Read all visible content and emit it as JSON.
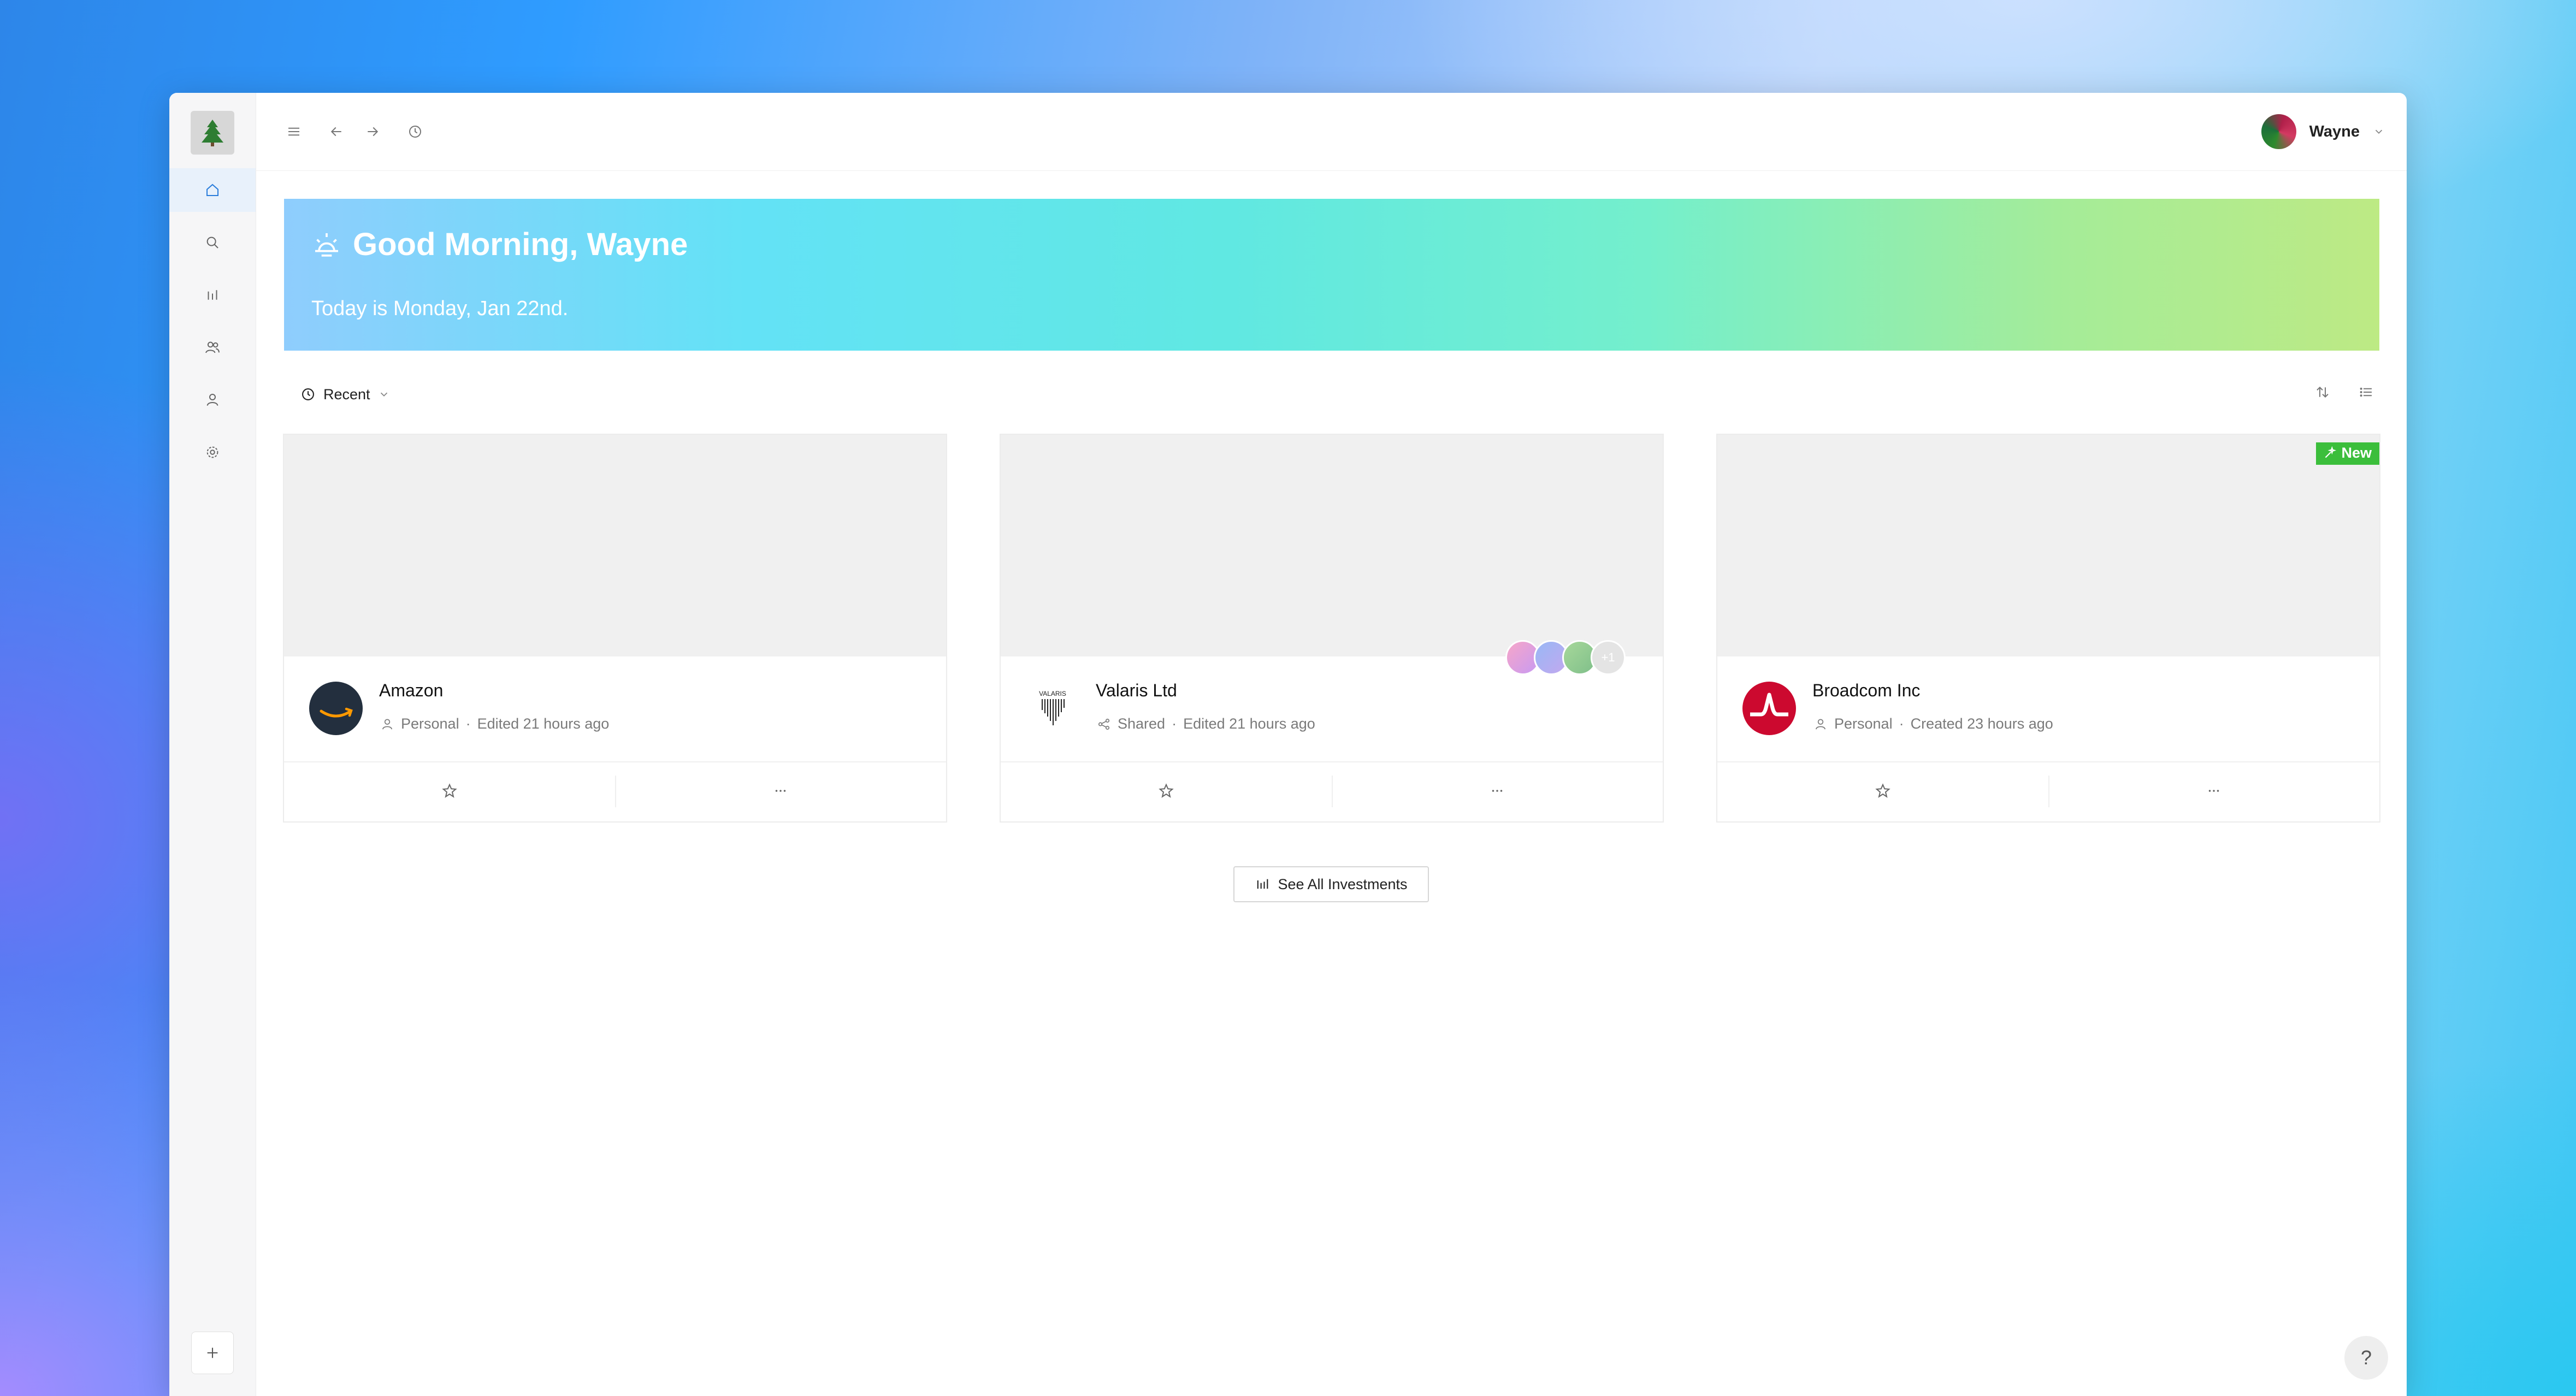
{
  "app": {
    "colors": {
      "accent": "#2a7ddb",
      "new_badge": "#3bbe3b",
      "banner_start": "#8fcdfd",
      "banner_end": "#bdea84"
    }
  },
  "sidebar": {
    "logo_icon": "tree-icon",
    "items": [
      {
        "name": "home",
        "icon": "home-icon",
        "active": true
      },
      {
        "name": "search",
        "icon": "search-icon",
        "active": false
      },
      {
        "name": "analytics",
        "icon": "bar-chart-icon",
        "active": false
      },
      {
        "name": "team",
        "icon": "users-icon",
        "active": false
      },
      {
        "name": "profile",
        "icon": "user-icon",
        "active": false
      },
      {
        "name": "settings",
        "icon": "gear-icon",
        "active": false
      }
    ],
    "add_icon": "plus-icon"
  },
  "topbar": {
    "icons": [
      "menu-icon",
      "back-arrow-icon",
      "forward-arrow-icon",
      "history-icon"
    ],
    "user_name": "Wayne"
  },
  "banner": {
    "greeting": "Good Morning, Wayne",
    "date_text": "Today is Monday, Jan 22nd."
  },
  "filter": {
    "label": "Recent",
    "tools": [
      "sort-icon",
      "list-view-icon"
    ]
  },
  "cards": [
    {
      "name": "Amazon",
      "access": "Personal",
      "status": "Edited 21 hours ago",
      "access_icon": "user-icon"
    },
    {
      "name": "Valaris Ltd",
      "access": "Shared",
      "status": "Edited 21 hours ago",
      "access_icon": "share-icon",
      "logo_text": "VALARIS",
      "extra_collaborators": "+1"
    },
    {
      "name": "Broadcom Inc",
      "access": "Personal",
      "status": "Created 23 hours ago",
      "access_icon": "user-icon",
      "badge": "New"
    }
  ],
  "see_all_label": "See All Investments",
  "help_label": "?"
}
